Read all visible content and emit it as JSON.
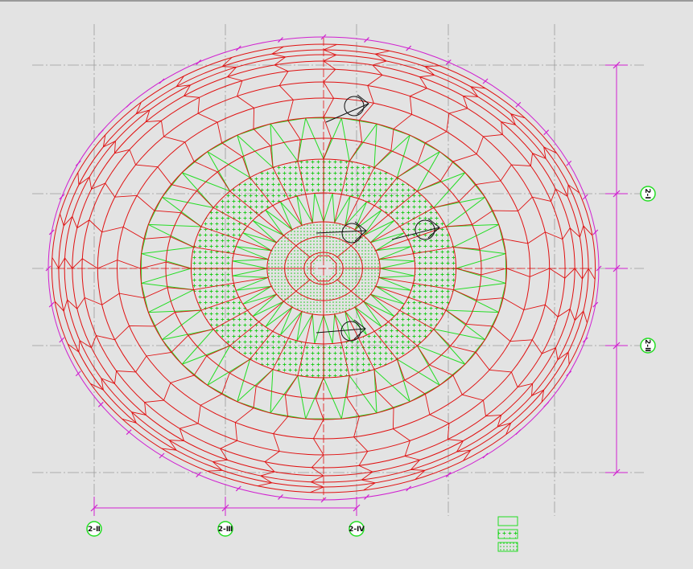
{
  "drawing": {
    "background": "#e3e3e3",
    "colors": {
      "grid_red": "#e01010",
      "truss_green": "#22dd22",
      "hatch_green": "#22cc22",
      "dimension_magenta": "#d020d0",
      "axis_gray": "#9a9a9a",
      "marker_black": "#111111"
    },
    "bottom_axes": [
      {
        "id": "axis-b1",
        "label": "2-Ⅱ"
      },
      {
        "id": "axis-b2",
        "label": "2-Ⅲ"
      },
      {
        "id": "axis-b3",
        "label": "2-Ⅳ"
      }
    ],
    "right_axes": [
      {
        "id": "axis-r1",
        "label": "2-Ⅰ"
      },
      {
        "id": "axis-r2",
        "label": "2-Ⅱ"
      }
    ],
    "legend": [
      {
        "id": "legend-plain",
        "pattern": "plain"
      },
      {
        "id": "legend-crosshatch",
        "pattern": "cross-hatch"
      },
      {
        "id": "legend-dots",
        "pattern": "dots"
      }
    ]
  }
}
